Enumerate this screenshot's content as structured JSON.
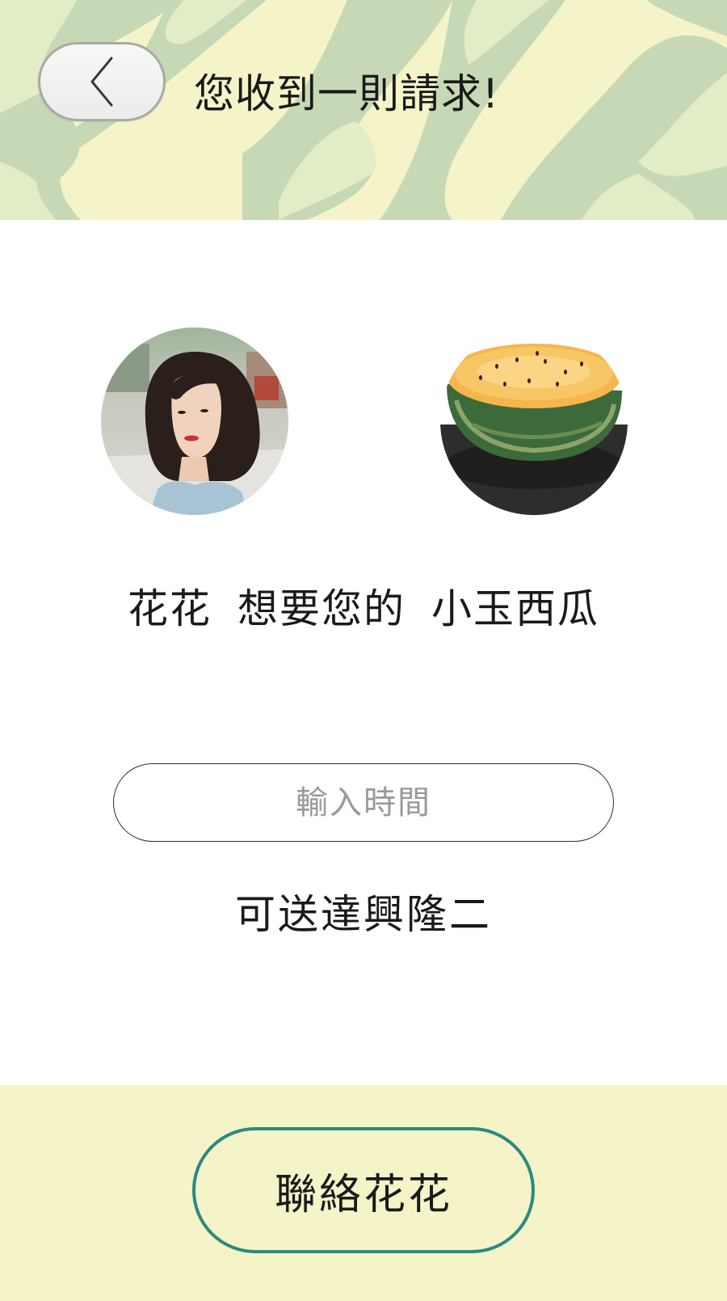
{
  "header": {
    "title": "您收到一則請求!",
    "back_icon": "chevron-left-icon"
  },
  "request": {
    "requester_name": "花花",
    "action_text": "想要您的",
    "product_name": "小玉西瓜"
  },
  "avatars": {
    "requester": "requester-photo",
    "product": "watermelon-photo"
  },
  "time_input": {
    "placeholder": "輸入時間",
    "value": ""
  },
  "delivery_note": "可送達興隆二",
  "footer": {
    "contact_button_label": "聯絡花花"
  },
  "colors": {
    "header_bg": "#f4f4c8",
    "wave_dark": "#c7d8b6",
    "wave_light": "#e2ecc6",
    "footer_bg": "#f4f4c8",
    "button_border": "#2a8a80",
    "text": "#1a1a1a",
    "placeholder": "#9a9a9a"
  }
}
